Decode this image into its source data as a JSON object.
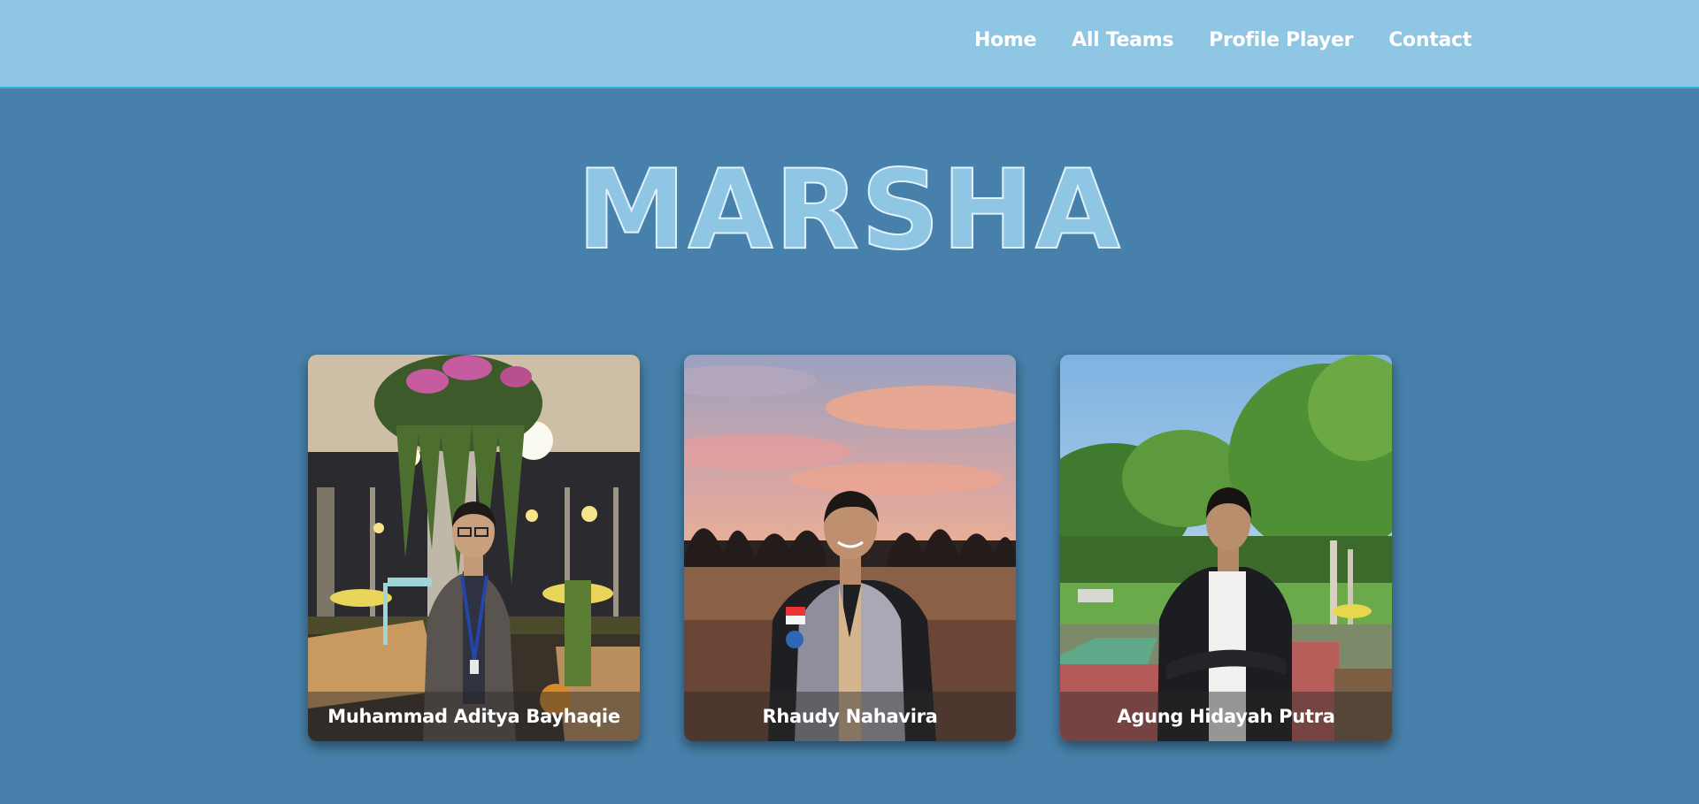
{
  "nav": {
    "items": [
      {
        "label": "Home"
      },
      {
        "label": "All Teams"
      },
      {
        "label": "Profile Player"
      },
      {
        "label": "Contact"
      }
    ]
  },
  "team": {
    "title": "MARSHA"
  },
  "players": [
    {
      "name": "Muhammad Aditya Bayhaqie"
    },
    {
      "name": "Rhaudy Nahavira"
    },
    {
      "name": "Agung Hidayah Putra"
    }
  ],
  "colors": {
    "navbar_bg": "#8fc6e3",
    "page_bg": "#4781ab",
    "accent_line": "#29b6de",
    "title_fill": "#8fc6e3"
  }
}
